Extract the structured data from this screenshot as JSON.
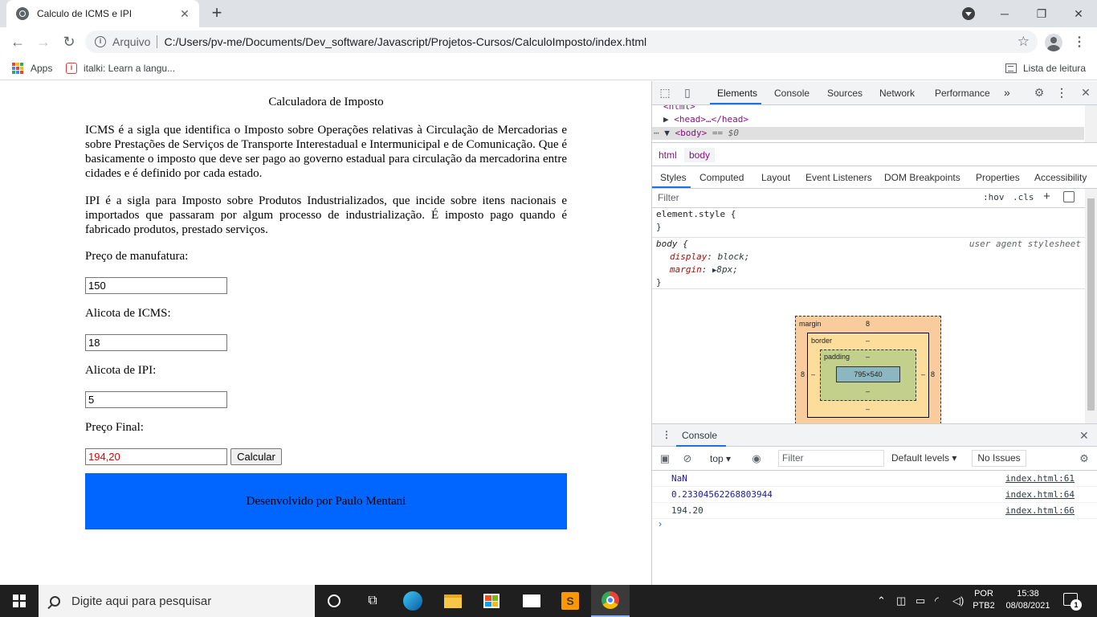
{
  "browser": {
    "tab_title": "Calculo de ICMS e IPI",
    "tab_close": "✕",
    "new_tab": "+",
    "scheme_label": "Arquivo",
    "url": "C:/Users/pv-me/Documents/Dev_software/Javascript/Projetos-Cursos/CalculoImposto/index.html",
    "bookmarks": [
      "Apps",
      "italki: Learn a langu..."
    ],
    "reading_list": "Lista de leitura",
    "window_controls": [
      "─",
      "❐",
      "✕"
    ]
  },
  "page": {
    "title": "Calculadora de Imposto",
    "icms_paragraph": "ICMS é a sigla que identifica o Imposto sobre Operações relativas à Circulação de Mercadorias e sobre Prestações de Serviços de Transporte Interestadual e Intermunicipal e de Comunicação. Que é basicamente o imposto que deve ser pago ao governo estadual para circulação da mercadorina entre cidades e é definido por cada estado.",
    "ipi_paragraph": "IPI é a sigla para Imposto sobre Produtos Industrializados, que incide sobre itens nacionais e importados que passaram por algum processo de industrialização. É imposto pago quando é fabricado produtos, prestado serviços.",
    "manufacture_label": "Preço de manufatura:",
    "manufacture_value": "150",
    "icms_label": "Alicota de ICMS:",
    "icms_value": "18",
    "ipi_label": "Alicota de IPI:",
    "ipi_value": "5",
    "final_label": "Preço Final:",
    "final_value": "194,20",
    "calc_button": "Calcular",
    "footer_text": "Desenvolvido por Paulo Mentani",
    "footer_color": "#0066ff",
    "final_value_color": "#e00000"
  },
  "devtools": {
    "tabs": [
      "Elements",
      "Console",
      "Sources",
      "Network",
      "Performance"
    ],
    "more_tabs": "»",
    "dom": {
      "html_line": "<html>",
      "head_line": "<head>…</head>",
      "body_line": "<body>",
      "body_suffix": " == $0"
    },
    "breadcrumbs": [
      "html",
      "body"
    ],
    "sub_tabs": [
      "Styles",
      "Computed",
      "Layout",
      "Event Listeners",
      "DOM Breakpoints",
      "Properties",
      "Accessibility"
    ],
    "filter_placeholder": "Filter",
    "hov": ":hov",
    "cls": ".cls",
    "element_style_open": "element.style {",
    "close_brace": "}",
    "body_rule_selector": "body {",
    "user_agent": "user agent stylesheet",
    "display_prop": "display",
    "display_val": "block;",
    "margin_prop": "margin",
    "margin_val": "8px;",
    "box_model": {
      "margin_label": "margin",
      "margin_top": "8",
      "margin_left": "8",
      "margin_right": "8",
      "border_label": "border",
      "border_dash": "–",
      "padding_label": "padding",
      "content_size": "795×540"
    },
    "console": {
      "drawer_title": "Console",
      "context": "top",
      "filter_placeholder": "Filter",
      "levels": "Default levels",
      "issues": "No Issues",
      "logs": [
        {
          "msg": "NaN",
          "src": "index.html:61",
          "color": "#1a1aa6"
        },
        {
          "msg": "0.23304562268803944",
          "src": "index.html:64",
          "color": "#1a1aa6"
        },
        {
          "msg": "194.20",
          "src": "index.html:66",
          "color": "#303942"
        }
      ],
      "prompt": "›"
    }
  },
  "taskbar": {
    "search_placeholder": "Digite aqui para pesquisar",
    "lang_line1": "POR",
    "lang_line2": "PTB2",
    "time": "15:38",
    "date": "08/08/2021",
    "notifications": "1"
  }
}
